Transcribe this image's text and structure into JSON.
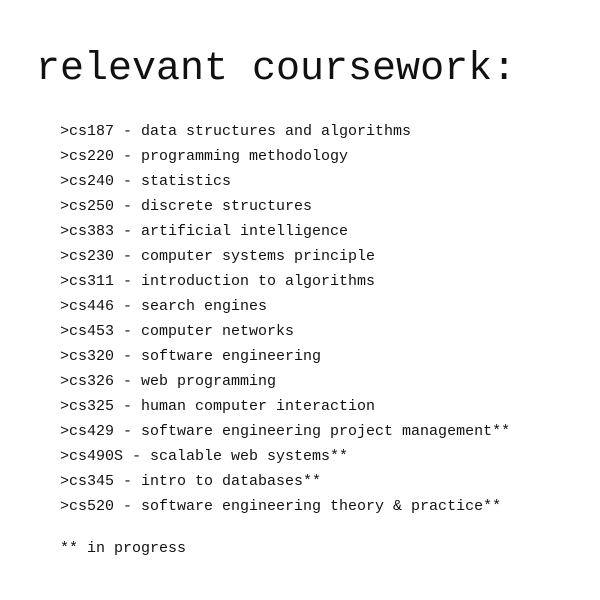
{
  "heading": "relevant coursework:",
  "courses": [
    ">cs187 - data structures and algorithms",
    ">cs220 - programming methodology",
    ">cs240 - statistics",
    ">cs250 - discrete structures",
    ">cs383 - artificial intelligence",
    ">cs230 - computer systems principle",
    ">cs311 - introduction to algorithms",
    ">cs446 - search engines",
    ">cs453 - computer networks",
    ">cs320 - software engineering",
    ">cs326 - web programming",
    ">cs325 - human computer interaction",
    ">cs429 - software engineering project management**",
    ">cs490S - scalable web systems**",
    ">cs345 - intro to databases**",
    ">cs520 - software engineering theory & practice**"
  ],
  "footnote": "** in progress"
}
